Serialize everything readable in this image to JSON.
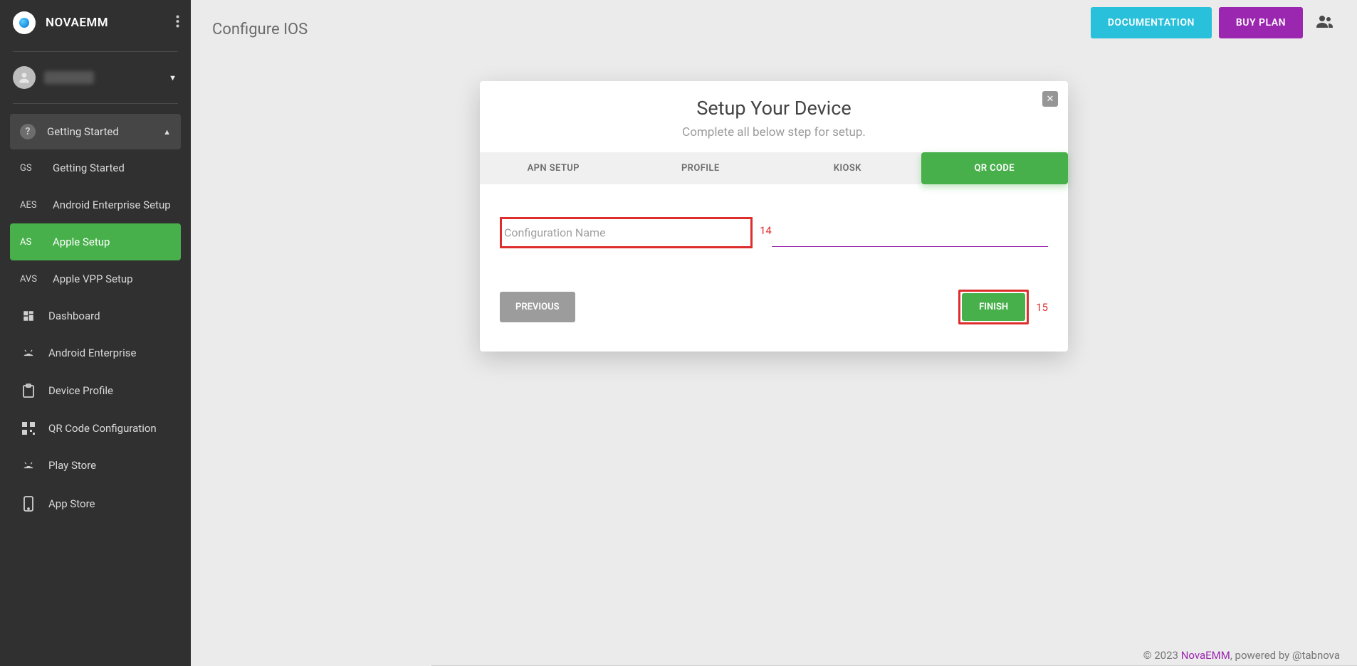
{
  "brand": {
    "name": "NOVAEMM"
  },
  "sidebar": {
    "group_header": "Getting Started",
    "sub_items": [
      {
        "abbr": "GS",
        "label": "Getting Started"
      },
      {
        "abbr": "AES",
        "label": "Android Enterprise Setup"
      },
      {
        "abbr": "AS",
        "label": "Apple Setup",
        "active": true
      },
      {
        "abbr": "AVS",
        "label": "Apple VPP Setup"
      }
    ],
    "items": [
      {
        "label": "Dashboard"
      },
      {
        "label": "Android Enterprise"
      },
      {
        "label": "Device Profile"
      },
      {
        "label": "QR Code Configuration"
      },
      {
        "label": "Play Store"
      },
      {
        "label": "App Store"
      }
    ]
  },
  "header": {
    "title": "Configure IOS",
    "doc_label": "DOCUMENTATION",
    "buy_label": "BUY PLAN"
  },
  "card": {
    "title": "Setup Your Device",
    "subtitle": "Complete all below step for setup.",
    "tabs": [
      {
        "label": "APN SETUP"
      },
      {
        "label": "PROFILE"
      },
      {
        "label": "KIOSK"
      },
      {
        "label": "QR CODE",
        "active": true
      }
    ],
    "config_placeholder": "Configuration Name",
    "config_value": "",
    "prev_label": "PREVIOUS",
    "finish_label": "FINISH"
  },
  "annotations": {
    "a14": "14",
    "a15": "15"
  },
  "footer": {
    "copyright_prefix": "© 2023 ",
    "brand": "NovaEMM",
    "powered": ", powered by @tabnova"
  }
}
